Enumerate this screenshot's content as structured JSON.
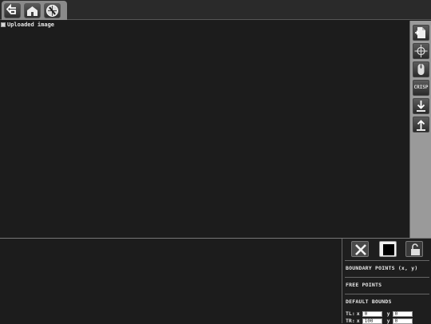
{
  "toolbar": {
    "icons": [
      "back-arrow-icon",
      "home-icon",
      "safari-compass-icon"
    ]
  },
  "canvas": {
    "broken_image_alt": "Uploaded image"
  },
  "right_toolbar": {
    "icons": [
      "new-document-icon",
      "crosshair-icon",
      "mouse-icon",
      "crisp-label",
      "download-icon",
      "upload-icon"
    ],
    "crisp_label": "CRISP"
  },
  "panel": {
    "icons": [
      "close-x-icon",
      "black-square-icon",
      "unlock-icon"
    ],
    "boundary_points_label": "BOUNDARY POINTS (x, y)",
    "free_points_label": "FREE POINTS",
    "default_bounds_label": "DEFAULT BOUNDS",
    "rows": [
      {
        "label": "TL:",
        "x_axis": "x",
        "x_value": "0",
        "y_axis": "y",
        "y_value": "0"
      },
      {
        "label": "TR:",
        "x_axis": "x",
        "x_value": "100",
        "y_axis": "y",
        "y_value": "0"
      }
    ]
  },
  "colors": {
    "background": "#1c1c1c",
    "sidebar": "#9a9a9a",
    "text": "#e6e6e6"
  }
}
